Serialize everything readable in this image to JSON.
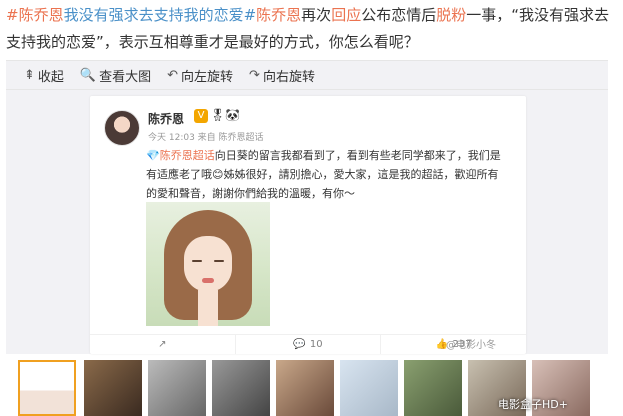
{
  "post": {
    "tag1": "#陈乔恩",
    "tag2": "我没有强求去支持我的恋爱#",
    "tag3": "陈乔恩",
    "text1": "再次",
    "link1": "回应",
    "text2": "公布恋情后",
    "link2": "脱粉",
    "text3": "一事，“我没有强求去支持我的恋爱”，表示互相尊重才是最好的方式，你怎么看呢？"
  },
  "toolbar": {
    "collapse": "收起",
    "view_large": "查看大图",
    "rotate_left": "向左旋转",
    "rotate_right": "向右旋转"
  },
  "card": {
    "username": "陈乔恩",
    "meta": "今天 12:03 来自 陈乔恩超话",
    "supertopic": "陈乔恩超话",
    "body": "向日葵的留言我都看到了，看到有些老同学都来了，我们是有适應老了哦😊姊姊很好，請別擔心，愛大家，這是我的超話，歡迎所有的愛和聲音，謝謝你們給我的溫暖，有你～",
    "comments": "10",
    "likes": "237",
    "watermark": "@电影小冬"
  },
  "thumbs_watermark": "电影盒子HD+",
  "colors": {
    "orange": "#eb7350",
    "blue": "#4a90c8"
  }
}
